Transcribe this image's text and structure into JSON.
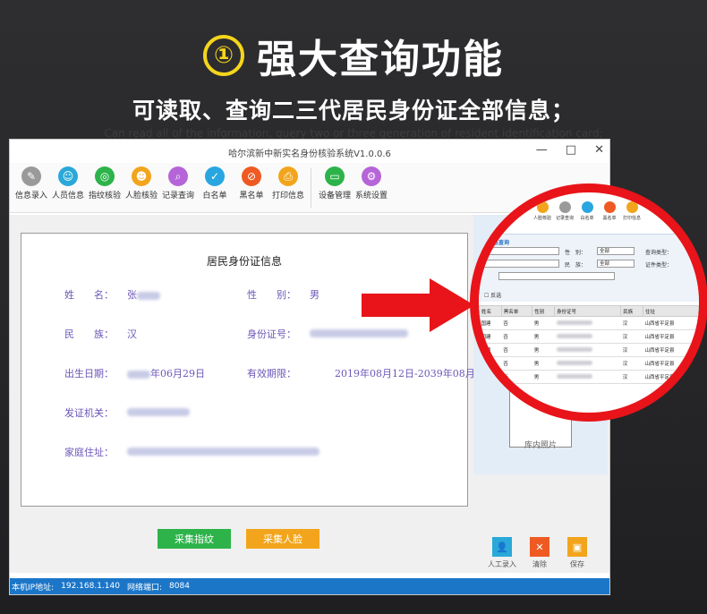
{
  "banner": {
    "number": "①",
    "headline": "强大查询功能",
    "subhead": "可读取、查询二三代居民身份证全部信息；",
    "subhead_en": "Can read all of the information, query two or three generation of resident identification card;"
  },
  "window": {
    "title": "哈尔滨新中新实名身份核验系统V1.0.0.6",
    "controls": {
      "minimize": "—",
      "maximize": "□",
      "close": "✕"
    }
  },
  "toolbar": {
    "items": [
      {
        "label": "信息录入",
        "color": "#9a9a9a",
        "icon": "pen-icon"
      },
      {
        "label": "人员信息",
        "color": "#2aa9d8",
        "icon": "users-icon"
      },
      {
        "label": "指纹核验",
        "color": "#2db34a",
        "icon": "fingerprint-icon"
      },
      {
        "label": "人脸核验",
        "color": "#f2a51c",
        "icon": "face-icon"
      },
      {
        "label": "记录查询",
        "color": "#b565d8",
        "icon": "search-icon"
      },
      {
        "label": "白名单",
        "color": "#29a6e0",
        "icon": "check-icon"
      },
      {
        "label": "黑名单",
        "color": "#ef5a23",
        "icon": "ban-icon"
      },
      {
        "label": "打印信息",
        "color": "#f2a51c",
        "icon": "print-icon"
      }
    ],
    "items2": [
      {
        "label": "设备管理",
        "color": "#2db34a",
        "icon": "device-icon"
      },
      {
        "label": "系统设置",
        "color": "#b565d8",
        "icon": "gear-icon"
      }
    ]
  },
  "card": {
    "title": "居民身份证信息",
    "name_label": "姓　　名：",
    "name_value": "张",
    "gender_label": "性　　别：",
    "gender_value": "男",
    "ethnicity_label": "民　　族：",
    "ethnicity_value": "汉",
    "id_label": "身份证号：",
    "birth_label": "出生日期：",
    "birth_value": "年06月29日",
    "validity_label": "有效期限：",
    "validity_value": "2019年08月12日-2039年08月12日",
    "authority_label": "发证机关：",
    "address_label": "家庭住址："
  },
  "buttons": {
    "collect_fingerprint": "采集指纹",
    "collect_face": "采集人脸"
  },
  "right_panel": {
    "photo_label": "库内照片",
    "manual_entry": "人工录入",
    "clear": "清除",
    "save": "保存"
  },
  "statusbar": {
    "ip_label": "本机IP地址:",
    "ip_value": "192.168.1.140",
    "port_label": "网络端口:",
    "port_value": "8084"
  },
  "magnifier": {
    "toolbar": [
      "人脸核验",
      "记录查询",
      "白名单",
      "黑名单",
      "打印信息"
    ],
    "panel_title": "信息查询",
    "gender_label": "性　别：",
    "gender_value": "全部",
    "ethnicity_label": "民　族：",
    "ethnicity_value": "全部",
    "query_type": "查询类型：",
    "id_type": "证件类型：",
    "reverse": "反选",
    "columns": [
      "姓名",
      "黑名单",
      "性别",
      "身份证号",
      "民族",
      "住址"
    ],
    "rows": [
      {
        "name": "国建",
        "black": "否",
        "gender": "男",
        "nation": "汉",
        "addr": "山西省平定县"
      },
      {
        "name": "国建",
        "black": "否",
        "gender": "男",
        "nation": "汉",
        "addr": "山西省平定县"
      },
      {
        "name": "国建",
        "black": "否",
        "gender": "男",
        "nation": "汉",
        "addr": "山西省平定县"
      },
      {
        "name": "",
        "black": "否",
        "gender": "男",
        "nation": "汉",
        "addr": "山西省平定县"
      },
      {
        "name": "",
        "black": "否",
        "gender": "男",
        "nation": "汉",
        "addr": "山西省平定县"
      }
    ]
  }
}
